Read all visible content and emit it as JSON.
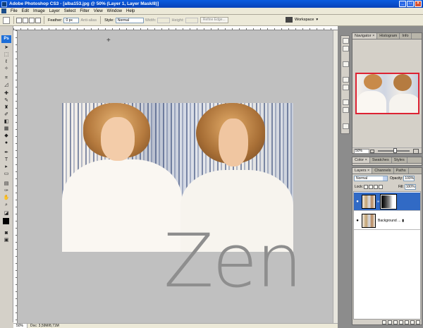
{
  "window": {
    "title": "Adobe Photoshop CS3 - [alba153.jpg @ 50% (Layer 1, Layer Mask/8)]",
    "buttons": [
      "_",
      "□",
      "×"
    ]
  },
  "menu": [
    "File",
    "Edit",
    "Image",
    "Layer",
    "Select",
    "Filter",
    "View",
    "Window",
    "Help"
  ],
  "options": {
    "feather_label": "Feather:",
    "feather_value": "0 px",
    "antialias_label": "Anti-alias",
    "style_label": "Style:",
    "style_value": "Normal",
    "width_label": "Width:",
    "height_label": "Height:",
    "refine_edge": "Refine Edge...",
    "workspace_label": "Workspace"
  },
  "toolbox": {
    "badge": "Ps"
  },
  "canvas": {
    "overlay_text": "Zen"
  },
  "status": {
    "zoom": "50%",
    "doc": "Doc: 3,59M/8,71M"
  },
  "navigator": {
    "tabs": [
      "Navigator ×",
      "Histogram",
      "Info"
    ],
    "zoom_value": "50%"
  },
  "color_panel": {
    "tabs": [
      "Color ×",
      "Swatches",
      "Styles"
    ]
  },
  "layers_panel": {
    "tabs": [
      "Layers ×",
      "Channels",
      "Paths"
    ],
    "blend_mode": "Normal",
    "opacity_label": "Opacity:",
    "opacity_value": "100%",
    "lock_label": "Lock:",
    "fill_label": "Fill:",
    "fill_value": "100%",
    "layers": [
      {
        "name": "",
        "selected": true
      },
      {
        "name": "Background ...",
        "selected": false
      }
    ]
  },
  "colors": {
    "accent": "#316ac5",
    "title_bar": "#0a5ce0",
    "nav_box": "#dd2233"
  }
}
